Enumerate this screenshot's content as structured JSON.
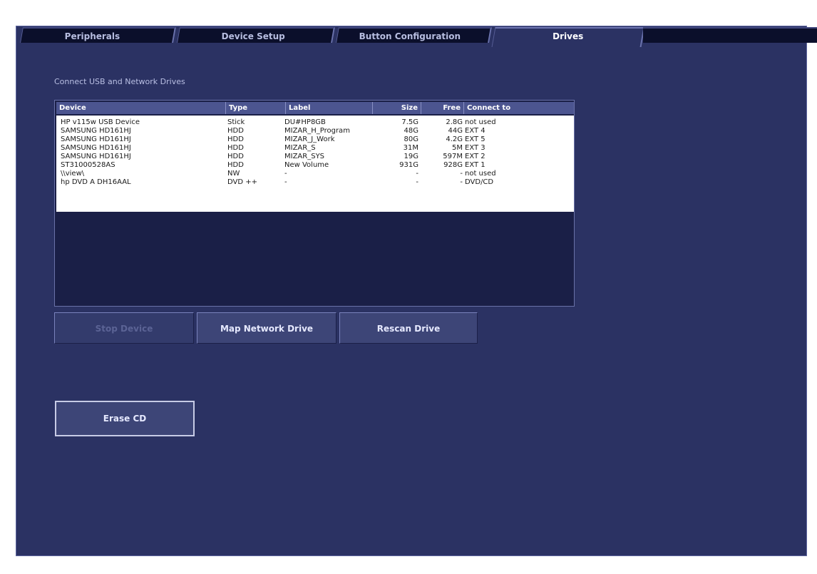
{
  "tabs": [
    {
      "label": "Peripherals",
      "active": false
    },
    {
      "label": "Device Setup",
      "active": false
    },
    {
      "label": "Button Configuration",
      "active": false
    },
    {
      "label": "Drives",
      "active": true
    }
  ],
  "section_title": "Connect USB and Network Drives",
  "table": {
    "columns": [
      "Device",
      "Type",
      "Label",
      "Size",
      "Free",
      "Connect to"
    ],
    "rows": [
      {
        "device": "HP v115w USB Device",
        "type": "Stick",
        "label": "DU#HP8GB",
        "size": "7.5G",
        "free": "2.8G",
        "connect_to": "not used"
      },
      {
        "device": "SAMSUNG HD161HJ",
        "type": "HDD",
        "label": "MIZAR_H_Program",
        "size": "48G",
        "free": "44G",
        "connect_to": "EXT 4"
      },
      {
        "device": "SAMSUNG HD161HJ",
        "type": "HDD",
        "label": "MIZAR_J_Work",
        "size": "80G",
        "free": "4.2G",
        "connect_to": "EXT 5"
      },
      {
        "device": "SAMSUNG HD161HJ",
        "type": "HDD",
        "label": "MIZAR_S",
        "size": "31M",
        "free": "5M",
        "connect_to": "EXT 3"
      },
      {
        "device": "SAMSUNG HD161HJ",
        "type": "HDD",
        "label": "MIZAR_SYS",
        "size": "19G",
        "free": "597M",
        "connect_to": "EXT 2"
      },
      {
        "device": "ST31000528AS",
        "type": "HDD",
        "label": "New Volume",
        "size": "931G",
        "free": "928G",
        "connect_to": "EXT 1"
      },
      {
        "device": "\\\\view\\",
        "type": "NW",
        "label": "-",
        "size": "-",
        "free": "-",
        "connect_to": "not used"
      },
      {
        "device": "hp DVD A  DH16AAL",
        "type": "DVD ++",
        "label": "-",
        "size": "-",
        "free": "-",
        "connect_to": "DVD/CD"
      }
    ]
  },
  "buttons": {
    "stop_device": "Stop Device",
    "map_network_drive": "Map Network Drive",
    "rescan_drive": "Rescan Drive",
    "erase_cd": "Erase CD"
  },
  "colors": {
    "panel_bg": "#2b3263",
    "tab_inactive_bg": "#0b0f2b",
    "table_header_bg": "#4c5590",
    "table_body_bg": "#ffffff",
    "button_bg": "#3d4577"
  }
}
